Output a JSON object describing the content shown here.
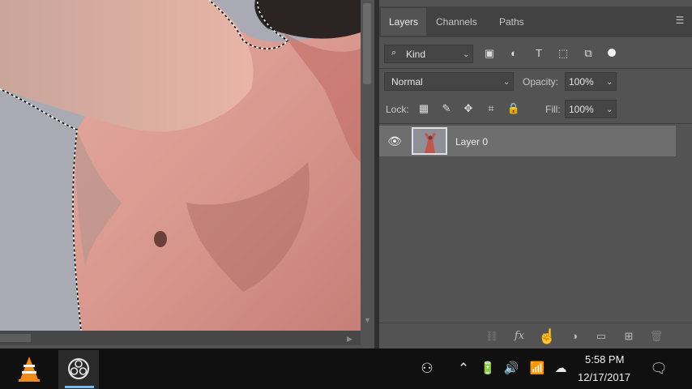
{
  "panel": {
    "tabs": [
      {
        "label": "Layers"
      },
      {
        "label": "Channels"
      },
      {
        "label": "Paths"
      }
    ],
    "filter": {
      "kind_label": "Kind"
    },
    "blend": {
      "mode": "Normal",
      "opacity_label": "Opacity:",
      "opacity_value": "100%"
    },
    "lock": {
      "label": "Lock:",
      "fill_label": "Fill:",
      "fill_value": "100%"
    },
    "layers": [
      {
        "name": "Layer 0",
        "visible": true
      }
    ]
  },
  "taskbar": {
    "time": "5:58 PM",
    "date": "12/17/2017"
  }
}
